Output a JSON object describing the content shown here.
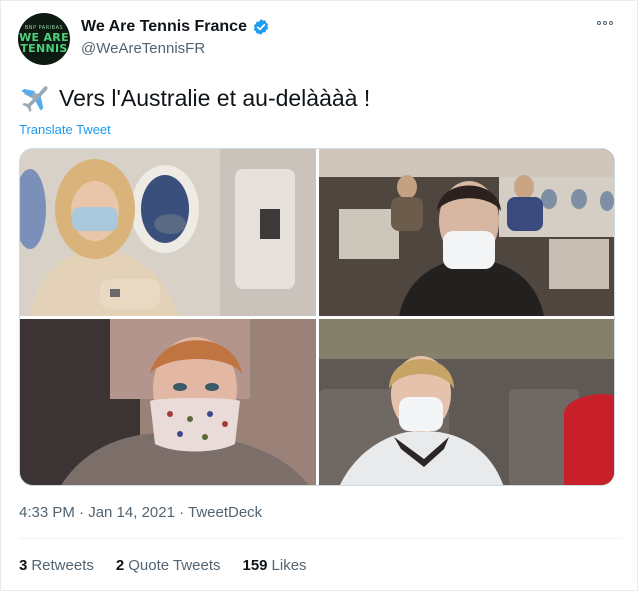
{
  "account": {
    "display_name": "We Are Tennis France",
    "handle": "@WeAreTennisFR",
    "verified": true,
    "avatar_text": {
      "top": "BNP PARIBAS",
      "line1": "WE ARE",
      "line2": "TENNIS"
    }
  },
  "tweet": {
    "text": "Vers l'Australie et au-delàààà !",
    "translate_label": "Translate Tweet",
    "timestamp": "4:33 PM · Jan 14, 2021 · TweetDeck"
  },
  "stats": {
    "retweets_count": "3",
    "retweets_label": "Retweets",
    "quotes_count": "2",
    "quotes_label": "Quote Tweets",
    "likes_count": "159",
    "likes_label": "Likes"
  },
  "colors": {
    "link": "#1d9bf0",
    "secondary_text": "#536471",
    "primary_text": "#0f1419"
  }
}
